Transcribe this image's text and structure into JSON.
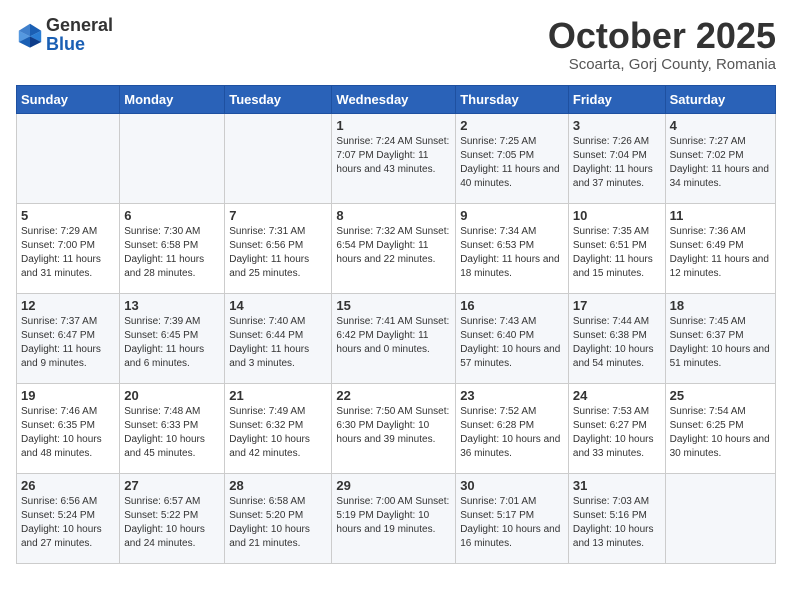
{
  "header": {
    "logo_general": "General",
    "logo_blue": "Blue",
    "month": "October 2025",
    "location": "Scoarta, Gorj County, Romania"
  },
  "weekdays": [
    "Sunday",
    "Monday",
    "Tuesday",
    "Wednesday",
    "Thursday",
    "Friday",
    "Saturday"
  ],
  "weeks": [
    [
      {
        "day": "",
        "info": ""
      },
      {
        "day": "",
        "info": ""
      },
      {
        "day": "",
        "info": ""
      },
      {
        "day": "1",
        "info": "Sunrise: 7:24 AM\nSunset: 7:07 PM\nDaylight: 11 hours\nand 43 minutes."
      },
      {
        "day": "2",
        "info": "Sunrise: 7:25 AM\nSunset: 7:05 PM\nDaylight: 11 hours\nand 40 minutes."
      },
      {
        "day": "3",
        "info": "Sunrise: 7:26 AM\nSunset: 7:04 PM\nDaylight: 11 hours\nand 37 minutes."
      },
      {
        "day": "4",
        "info": "Sunrise: 7:27 AM\nSunset: 7:02 PM\nDaylight: 11 hours\nand 34 minutes."
      }
    ],
    [
      {
        "day": "5",
        "info": "Sunrise: 7:29 AM\nSunset: 7:00 PM\nDaylight: 11 hours\nand 31 minutes."
      },
      {
        "day": "6",
        "info": "Sunrise: 7:30 AM\nSunset: 6:58 PM\nDaylight: 11 hours\nand 28 minutes."
      },
      {
        "day": "7",
        "info": "Sunrise: 7:31 AM\nSunset: 6:56 PM\nDaylight: 11 hours\nand 25 minutes."
      },
      {
        "day": "8",
        "info": "Sunrise: 7:32 AM\nSunset: 6:54 PM\nDaylight: 11 hours\nand 22 minutes."
      },
      {
        "day": "9",
        "info": "Sunrise: 7:34 AM\nSunset: 6:53 PM\nDaylight: 11 hours\nand 18 minutes."
      },
      {
        "day": "10",
        "info": "Sunrise: 7:35 AM\nSunset: 6:51 PM\nDaylight: 11 hours\nand 15 minutes."
      },
      {
        "day": "11",
        "info": "Sunrise: 7:36 AM\nSunset: 6:49 PM\nDaylight: 11 hours\nand 12 minutes."
      }
    ],
    [
      {
        "day": "12",
        "info": "Sunrise: 7:37 AM\nSunset: 6:47 PM\nDaylight: 11 hours\nand 9 minutes."
      },
      {
        "day": "13",
        "info": "Sunrise: 7:39 AM\nSunset: 6:45 PM\nDaylight: 11 hours\nand 6 minutes."
      },
      {
        "day": "14",
        "info": "Sunrise: 7:40 AM\nSunset: 6:44 PM\nDaylight: 11 hours\nand 3 minutes."
      },
      {
        "day": "15",
        "info": "Sunrise: 7:41 AM\nSunset: 6:42 PM\nDaylight: 11 hours\nand 0 minutes."
      },
      {
        "day": "16",
        "info": "Sunrise: 7:43 AM\nSunset: 6:40 PM\nDaylight: 10 hours\nand 57 minutes."
      },
      {
        "day": "17",
        "info": "Sunrise: 7:44 AM\nSunset: 6:38 PM\nDaylight: 10 hours\nand 54 minutes."
      },
      {
        "day": "18",
        "info": "Sunrise: 7:45 AM\nSunset: 6:37 PM\nDaylight: 10 hours\nand 51 minutes."
      }
    ],
    [
      {
        "day": "19",
        "info": "Sunrise: 7:46 AM\nSunset: 6:35 PM\nDaylight: 10 hours\nand 48 minutes."
      },
      {
        "day": "20",
        "info": "Sunrise: 7:48 AM\nSunset: 6:33 PM\nDaylight: 10 hours\nand 45 minutes."
      },
      {
        "day": "21",
        "info": "Sunrise: 7:49 AM\nSunset: 6:32 PM\nDaylight: 10 hours\nand 42 minutes."
      },
      {
        "day": "22",
        "info": "Sunrise: 7:50 AM\nSunset: 6:30 PM\nDaylight: 10 hours\nand 39 minutes."
      },
      {
        "day": "23",
        "info": "Sunrise: 7:52 AM\nSunset: 6:28 PM\nDaylight: 10 hours\nand 36 minutes."
      },
      {
        "day": "24",
        "info": "Sunrise: 7:53 AM\nSunset: 6:27 PM\nDaylight: 10 hours\nand 33 minutes."
      },
      {
        "day": "25",
        "info": "Sunrise: 7:54 AM\nSunset: 6:25 PM\nDaylight: 10 hours\nand 30 minutes."
      }
    ],
    [
      {
        "day": "26",
        "info": "Sunrise: 6:56 AM\nSunset: 5:24 PM\nDaylight: 10 hours\nand 27 minutes."
      },
      {
        "day": "27",
        "info": "Sunrise: 6:57 AM\nSunset: 5:22 PM\nDaylight: 10 hours\nand 24 minutes."
      },
      {
        "day": "28",
        "info": "Sunrise: 6:58 AM\nSunset: 5:20 PM\nDaylight: 10 hours\nand 21 minutes."
      },
      {
        "day": "29",
        "info": "Sunrise: 7:00 AM\nSunset: 5:19 PM\nDaylight: 10 hours\nand 19 minutes."
      },
      {
        "day": "30",
        "info": "Sunrise: 7:01 AM\nSunset: 5:17 PM\nDaylight: 10 hours\nand 16 minutes."
      },
      {
        "day": "31",
        "info": "Sunrise: 7:03 AM\nSunset: 5:16 PM\nDaylight: 10 hours\nand 13 minutes."
      },
      {
        "day": "",
        "info": ""
      }
    ]
  ]
}
